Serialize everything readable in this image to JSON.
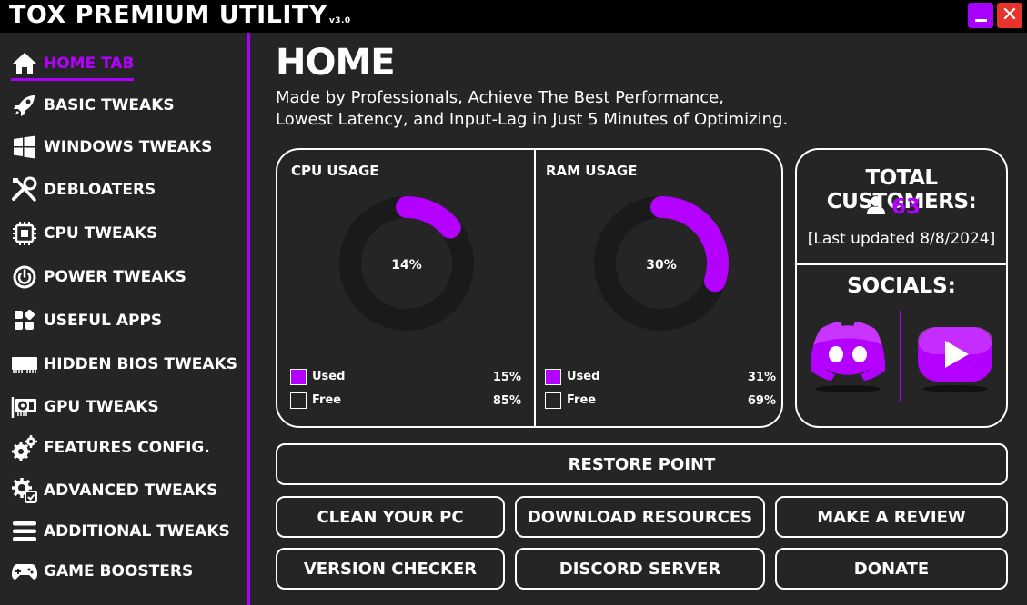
{
  "window": {
    "title": "TOX PREMIUM UTILITY",
    "version": "v3.0",
    "minimize_icon": "minimize-icon",
    "close_label": "✕"
  },
  "sidebar": {
    "items": [
      {
        "label": "HOME TAB",
        "icon": "home-icon",
        "active": true
      },
      {
        "label": "BASIC TWEAKS",
        "icon": "rocket-icon"
      },
      {
        "label": "WINDOWS TWEAKS",
        "icon": "windows-icon"
      },
      {
        "label": "DEBLOATERS",
        "icon": "tools-icon"
      },
      {
        "label": "CPU TWEAKS",
        "icon": "cpu-icon"
      },
      {
        "label": "POWER TWEAKS",
        "icon": "power-icon"
      },
      {
        "label": "USEFUL APPS",
        "icon": "apps-icon"
      },
      {
        "label": "HIDDEN BIOS TWEAKS",
        "icon": "ram-icon"
      },
      {
        "label": "GPU TWEAKS",
        "icon": "gpu-icon"
      },
      {
        "label": "FEATURES CONFIG.",
        "icon": "gears-icon"
      },
      {
        "label": "ADVANCED TWEAKS",
        "icon": "gear-check-icon"
      },
      {
        "label": "ADDITIONAL TWEAKS",
        "icon": "menu-icon"
      },
      {
        "label": "GAME BOOSTERS",
        "icon": "gamepad-icon"
      }
    ],
    "accent_color": "#a700ff"
  },
  "main": {
    "title": "HOME",
    "subtitle_line1": "Made by Professionals, Achieve The Best Performance,",
    "subtitle_line2": "Lowest Latency, and Input-Lag in Just 5 Minutes of Optimizing."
  },
  "cpu": {
    "title": "CPU USAGE",
    "center_label": "14%",
    "used_fraction": 0.14,
    "used_label": "Used",
    "used_value": "15%",
    "free_label": "Free",
    "free_value": "85%"
  },
  "ram": {
    "title": "RAM USAGE",
    "center_label": "30%",
    "used_fraction": 0.3,
    "used_label": "Used",
    "used_value": "31%",
    "free_label": "Free",
    "free_value": "69%"
  },
  "customers": {
    "title": "TOTAL CUSTOMERS:",
    "count": "63",
    "updated": "[Last updated 8/8/2024]",
    "user_icon": "user-icon"
  },
  "socials": {
    "title": "SOCIALS:",
    "discord_icon": "discord-icon",
    "youtube_icon": "youtube-icon"
  },
  "buttons": {
    "restore_point": "RESTORE POINT",
    "clean_pc": "CLEAN YOUR PC",
    "download_resources": "DOWNLOAD RESOURCES",
    "make_review": "MAKE A REVIEW",
    "version_checker": "VERSION CHECKER",
    "discord_server": "DISCORD SERVER",
    "donate": "DONATE"
  },
  "colors": {
    "accent": "#b400ff",
    "background": "#252525",
    "titlebar": "#000000",
    "close_button": "#e8332c",
    "ring_track": "#1a1a1a"
  }
}
